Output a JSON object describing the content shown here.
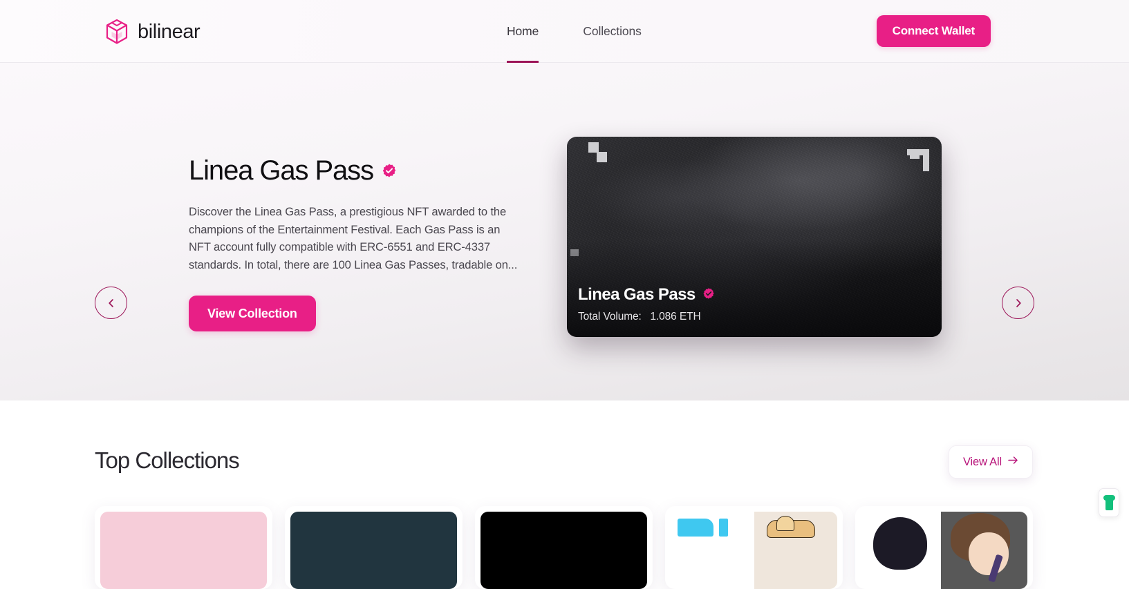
{
  "header": {
    "logo": {
      "text": "bilinear",
      "icon": "cube-logo-icon"
    },
    "nav": [
      {
        "label": "Home",
        "active": true
      },
      {
        "label": "Collections",
        "active": false
      }
    ],
    "connect_wallet_label": "Connect Wallet"
  },
  "hero": {
    "title": "Linea Gas Pass",
    "verified_icon": "verified-badge-icon",
    "description": "Discover the Linea Gas Pass, a prestigious NFT awarded to the champions of the Entertainment Festival. Each Gas Pass is an NFT account fully compatible with ERC-6551 and ERC-4337 standards. In total, there are 100 Linea Gas Passes, tradable on...",
    "cta_label": "View Collection",
    "prev_icon": "chevron-left-icon",
    "next_icon": "chevron-right-icon",
    "card": {
      "name": "Linea Gas Pass",
      "verified_icon": "verified-badge-icon",
      "volume_label": "Total Volume:",
      "volume_value": "1.086 ETH"
    },
    "pagination": [
      {
        "active": true
      },
      {
        "active": false
      },
      {
        "active": false
      }
    ]
  },
  "collections": {
    "title": "Top Collections",
    "view_all_label": "View All",
    "view_all_icon": "arrow-right-icon",
    "cards": [
      {
        "thumb": "thumb-pink"
      },
      {
        "thumb": "thumb-navy"
      },
      {
        "thumb": "thumb-black"
      },
      {
        "thumb": "thumb-anime"
      },
      {
        "thumb": "thumb-dark-anime"
      }
    ]
  },
  "extension": {
    "icon": "bitwarden-extension-icon"
  },
  "colors": {
    "accent": "#e81f86",
    "accent_dark": "#9c1458",
    "active_bar": "#b2146b",
    "text_dark": "#100f12",
    "text_body": "#4a474f"
  }
}
